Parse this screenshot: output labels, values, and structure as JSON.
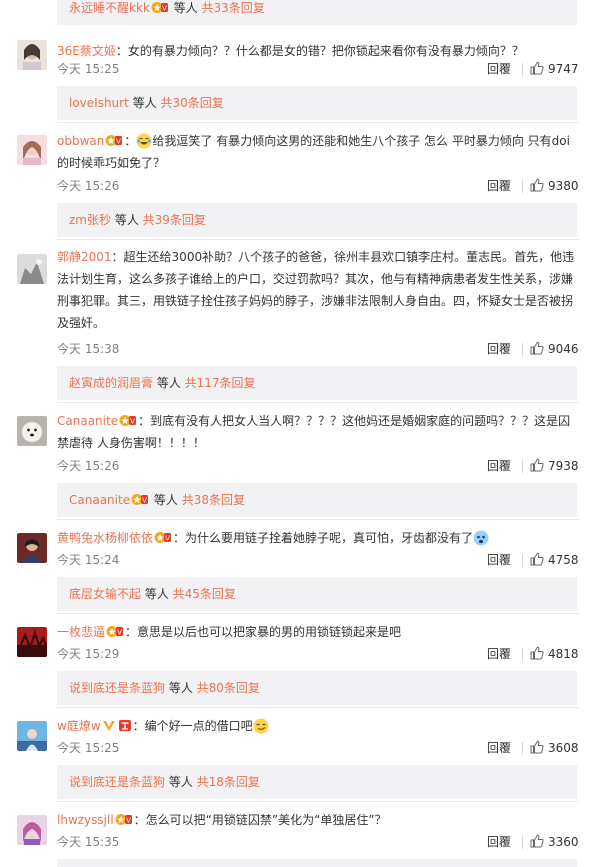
{
  "comments": [
    {
      "user": "36E蔡文姬",
      "text": "：女的有暴力倾向？？什么都是女的错？把你锁起来看你有没有暴力倾向？？",
      "time": "今天 15:25",
      "reply_label": "回覆",
      "likes": "9747",
      "reply": {
        "user": "loveIshurt",
        "mid": " 等人 ",
        "count": "共30条回复"
      }
    },
    {
      "user": "obbwan",
      "text_pre": "：",
      "text": "给我逗笑了 有暴力倾向这男的还能和她生八个孩子 怎么 平时暴力倾向 只有doi的时候乖巧如免了？",
      "time": "今天 15:26",
      "reply_label": "回覆",
      "likes": "9380",
      "reply": {
        "user": "zm张秒",
        "mid": " 等人 ",
        "count": "共39条回复"
      }
    },
    {
      "user": "郭静2001",
      "text": "：超生还给3000补助？八个孩子的爸爸，徐州丰县欢口镇李庄村。董志民。首先，他违法计划生育，这么多孩子谁给上的户口，交过罚款吗？其次，他与有精神病患者发生性关系，涉嫌刑事犯罪。其三，用铁链子拴住孩子妈妈的脖子，涉嫌非法限制人身自由。四，怀疑女士是否被拐及强奸。",
      "time": "今天 15:38",
      "reply_label": "回覆",
      "likes": "9046",
      "reply": {
        "user": "赵寅成的润眉膏",
        "mid": " 等人 ",
        "count": "共117条回复"
      }
    },
    {
      "user": "Canaanite",
      "text": "：到底有没有人把女人当人啊？？？？这他妈还是婚姻家庭的问题吗？？？这是囚禁虐待 人身伤害啊！！！！",
      "time": "今天 15:26",
      "reply_label": "回覆",
      "likes": "7938",
      "reply": {
        "user": "Canaanite",
        "mid": " 等人 ",
        "count": "共38条回复"
      }
    },
    {
      "user": "黄鸭兔水杨柳依依",
      "text": "：为什么要用链子拴着她脖子呢，真可怕，牙齿都没有了",
      "time": "今天 15:24",
      "reply_label": "回覆",
      "likes": "4758",
      "reply": {
        "user": "底层女输不起",
        "mid": " 等人 ",
        "count": "共45条回复"
      }
    },
    {
      "user": "一枚悲逼",
      "text": "：意思是以后也可以把家暴的男的用锁链锁起来是吧",
      "time": "今天 15:29",
      "reply_label": "回覆",
      "likes": "4818",
      "reply": {
        "user": "说到底还是条蓝狗",
        "mid": " 等人 ",
        "count": "共80条回复"
      }
    },
    {
      "user": "w庭燎w",
      "text": "：编个好一点的借口吧",
      "time": "今天 15:25",
      "reply_label": "回覆",
      "likes": "3608",
      "reply": {
        "user": "说到底还是条蓝狗",
        "mid": " 等人 ",
        "count": "共18条回复"
      }
    },
    {
      "user": "lhwzyssjll",
      "text": "：怎么可以把“用锁链囚禁”美化为“单独居住”？",
      "time": "今天 15:35",
      "reply_label": "回覆",
      "likes": "3360"
    }
  ],
  "top_reply": {
    "user": "永远睡不醒kkk",
    "mid": " 等人 ",
    "count": "共33条回复"
  },
  "colors": {
    "link": "#eb7350",
    "reply_bg": "#f2f2f5",
    "badge": "#f5a623"
  }
}
